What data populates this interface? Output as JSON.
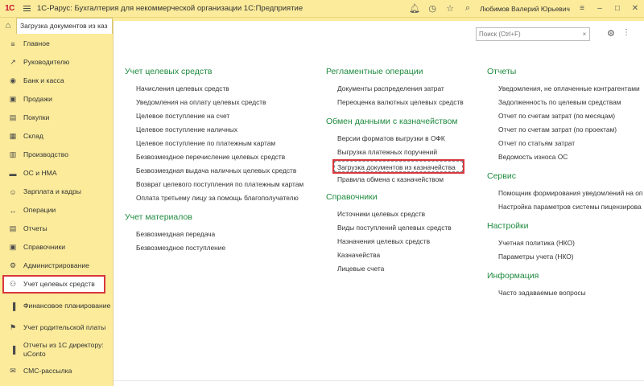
{
  "titlebar": {
    "logo": "1С",
    "title": "1С-Рарус: Бухгалтерия для некоммерческой организации 1С:Предприятие",
    "user": "Любимов Валерий Юрьевич",
    "icons": [
      "bell-icon",
      "history-icon",
      "star-icon",
      "search-icon"
    ]
  },
  "tabs": {
    "home_icon": "home-icon",
    "active_tab": "Загрузка документов из каз"
  },
  "sidebar": {
    "items": [
      {
        "label": "Главное",
        "icon": "list-icon"
      },
      {
        "label": "Руководителю",
        "icon": "trend-icon"
      },
      {
        "label": "Банк и касса",
        "icon": "coin-icon"
      },
      {
        "label": "Продажи",
        "icon": "bag-icon"
      },
      {
        "label": "Покупки",
        "icon": "cart-icon"
      },
      {
        "label": "Склад",
        "icon": "warehouse-icon"
      },
      {
        "label": "Производство",
        "icon": "factory-icon"
      },
      {
        "label": "ОС и НМА",
        "icon": "truck-icon"
      },
      {
        "label": "Зарплата и кадры",
        "icon": "person-icon"
      },
      {
        "label": "Операции",
        "icon": "operations-icon"
      },
      {
        "label": "Отчеты",
        "icon": "report-icon"
      },
      {
        "label": "Справочники",
        "icon": "book-icon"
      },
      {
        "label": "Администрирование",
        "icon": "gear-icon"
      },
      {
        "label": "Учет целевых средств",
        "icon": "target-funds-icon"
      },
      {
        "label": "Финансовое планирование",
        "icon": "chart-icon"
      },
      {
        "label": "Учет родительской платы",
        "icon": "parent-fee-icon"
      },
      {
        "label": "Отчеты из 1С директору: uConto",
        "icon": "bar-chart-icon"
      },
      {
        "label": "СМС-рассылка",
        "icon": "sms-icon"
      }
    ]
  },
  "search": {
    "placeholder": "Поиск (Ctrl+F)"
  },
  "sections": {
    "col1": [
      {
        "title": "Учет целевых средств",
        "links": [
          "Начисления целевых средств",
          "Уведомления на оплату целевых средств",
          "Целевое поступление на счет",
          "Целевое поступление наличных",
          "Целевое поступление по платежным картам",
          "Безвозмездное перечисление целевых средств",
          "Безвозмездная выдача наличных целевых средств",
          "Возврат целевого поступления по платежным картам",
          "Оплата третьему лицу за помощь благополучателю"
        ]
      },
      {
        "title": "Учет материалов",
        "links": [
          "Безвозмездная передача",
          "Безвозмездное поступление"
        ]
      }
    ],
    "col2": [
      {
        "title": "Регламентные операции",
        "links": [
          "Документы распределения затрат",
          "Переоценка валютных целевых средств"
        ]
      },
      {
        "title": "Обмен данными с казначейством",
        "links": [
          "Версии форматов выгрузки в ОФК",
          "Выгрузка платежных поручений",
          "Загрузка документов из казначейства",
          "Правила обмена с казначейством"
        ]
      },
      {
        "title": "Справочники",
        "links": [
          "Источники целевых средств",
          "Виды поступлений целевых средств",
          "Назначения целевых средств",
          "Казначейства",
          "Лицевые счета"
        ]
      }
    ],
    "col3": [
      {
        "title": "Отчеты",
        "links": [
          "Уведомления, не оплаченные контрагентами",
          "Задолженность по целевым средствам",
          "Отчет по счетам затрат (по месяцам)",
          "Отчет по счетам затрат (по проектам)",
          "Отчет по статьям затрат",
          "Ведомость износа ОС"
        ]
      },
      {
        "title": "Сервис",
        "links": [
          "Помощник формирования уведомлений на оп",
          "Настройка параметров системы пицензирова"
        ]
      },
      {
        "title": "Настройки",
        "links": [
          "Учетная политика (НКО)",
          "Параметры учета (НКО)"
        ]
      },
      {
        "title": "Информация",
        "links": [
          "Часто задаваемые вопросы"
        ]
      }
    ]
  },
  "colors": {
    "panel_bg": "#fbeb9b",
    "section_title": "#1e8a3e",
    "highlight": "#d9363e"
  }
}
